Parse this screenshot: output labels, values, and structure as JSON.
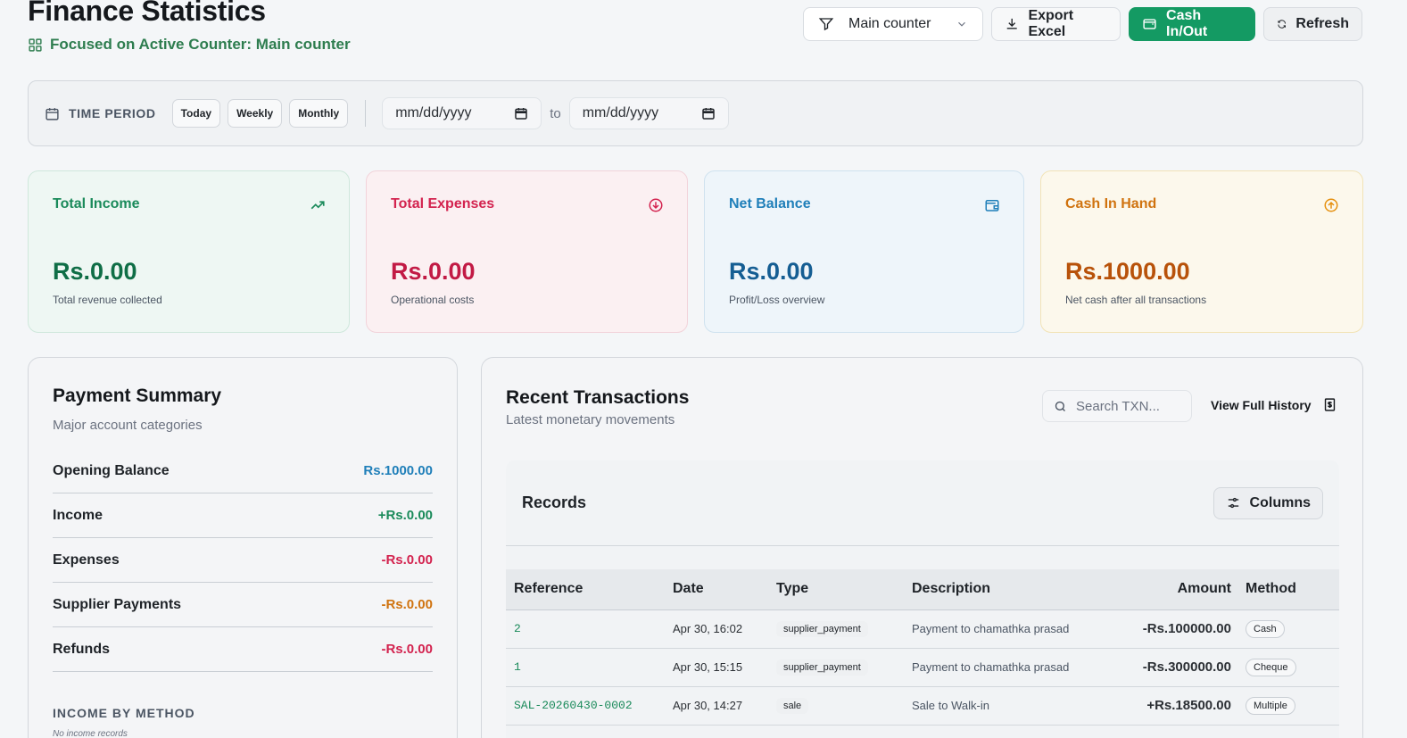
{
  "header": {
    "title": "Finance Statistics",
    "focus_text": "Focused on Active Counter: Main counter",
    "counter_select": "Main counter",
    "export_label": "Export Excel",
    "cash_label": "Cash In/Out",
    "refresh_label": "Refresh"
  },
  "period": {
    "label": "TIME PERIOD",
    "chips": [
      "Today",
      "Weekly",
      "Monthly"
    ],
    "from_placeholder": "mm/dd/yyyy",
    "to_text": "to",
    "to_placeholder": "mm/dd/yyyy"
  },
  "stats": {
    "income": {
      "label": "Total Income",
      "value": "Rs.0.00",
      "sub": "Total revenue collected",
      "icon": "trending-up-icon"
    },
    "expenses": {
      "label": "Total Expenses",
      "value": "Rs.0.00",
      "sub": "Operational costs",
      "icon": "arrow-down-circle-icon"
    },
    "balance": {
      "label": "Net Balance",
      "value": "Rs.0.00",
      "sub": "Profit/Loss overview",
      "icon": "wallet-icon"
    },
    "cash": {
      "label": "Cash In Hand",
      "value": "Rs.1000.00",
      "sub": "Net cash after all transactions",
      "icon": "arrow-up-circle-icon"
    }
  },
  "summary": {
    "title": "Payment Summary",
    "subtitle": "Major account categories",
    "rows": [
      {
        "label": "Opening Balance",
        "amount": "Rs.1000.00"
      },
      {
        "label": "Income",
        "amount": "+Rs.0.00"
      },
      {
        "label": "Expenses",
        "amount": "-Rs.0.00"
      },
      {
        "label": "Supplier Payments",
        "amount": "-Rs.0.00"
      },
      {
        "label": "Refunds",
        "amount": "-Rs.0.00"
      }
    ],
    "income_by_method_label": "INCOME BY METHOD",
    "no_income_text": "No income records"
  },
  "transactions": {
    "title": "Recent Transactions",
    "subtitle": "Latest monetary movements",
    "search_placeholder": "Search TXN...",
    "view_history_label": "View Full History",
    "records_title": "Records",
    "columns_label": "Columns",
    "headers": [
      "Reference",
      "Date",
      "Type",
      "Description",
      "Amount",
      "Method"
    ],
    "rows": [
      {
        "ref": "2",
        "date": "Apr 30, 16:02",
        "type": "supplier_payment",
        "desc": "Payment to chamathka prasad",
        "amount": "-Rs.100000.00",
        "method": "Cash"
      },
      {
        "ref": "1",
        "date": "Apr 30, 15:15",
        "type": "supplier_payment",
        "desc": "Payment to chamathka prasad",
        "amount": "-Rs.300000.00",
        "method": "Cheque"
      },
      {
        "ref": "SAL-20260430-0002",
        "date": "Apr 30, 14:27",
        "type": "sale",
        "desc": "Sale to Walk-in",
        "amount": "+Rs.18500.00",
        "method": "Multiple"
      }
    ]
  },
  "colors": {
    "accent_green": "#149a63",
    "income_green": "#1a8a5a",
    "expense_red": "#d3234f",
    "balance_blue": "#1f7fb9",
    "cash_orange": "#d0730f"
  }
}
